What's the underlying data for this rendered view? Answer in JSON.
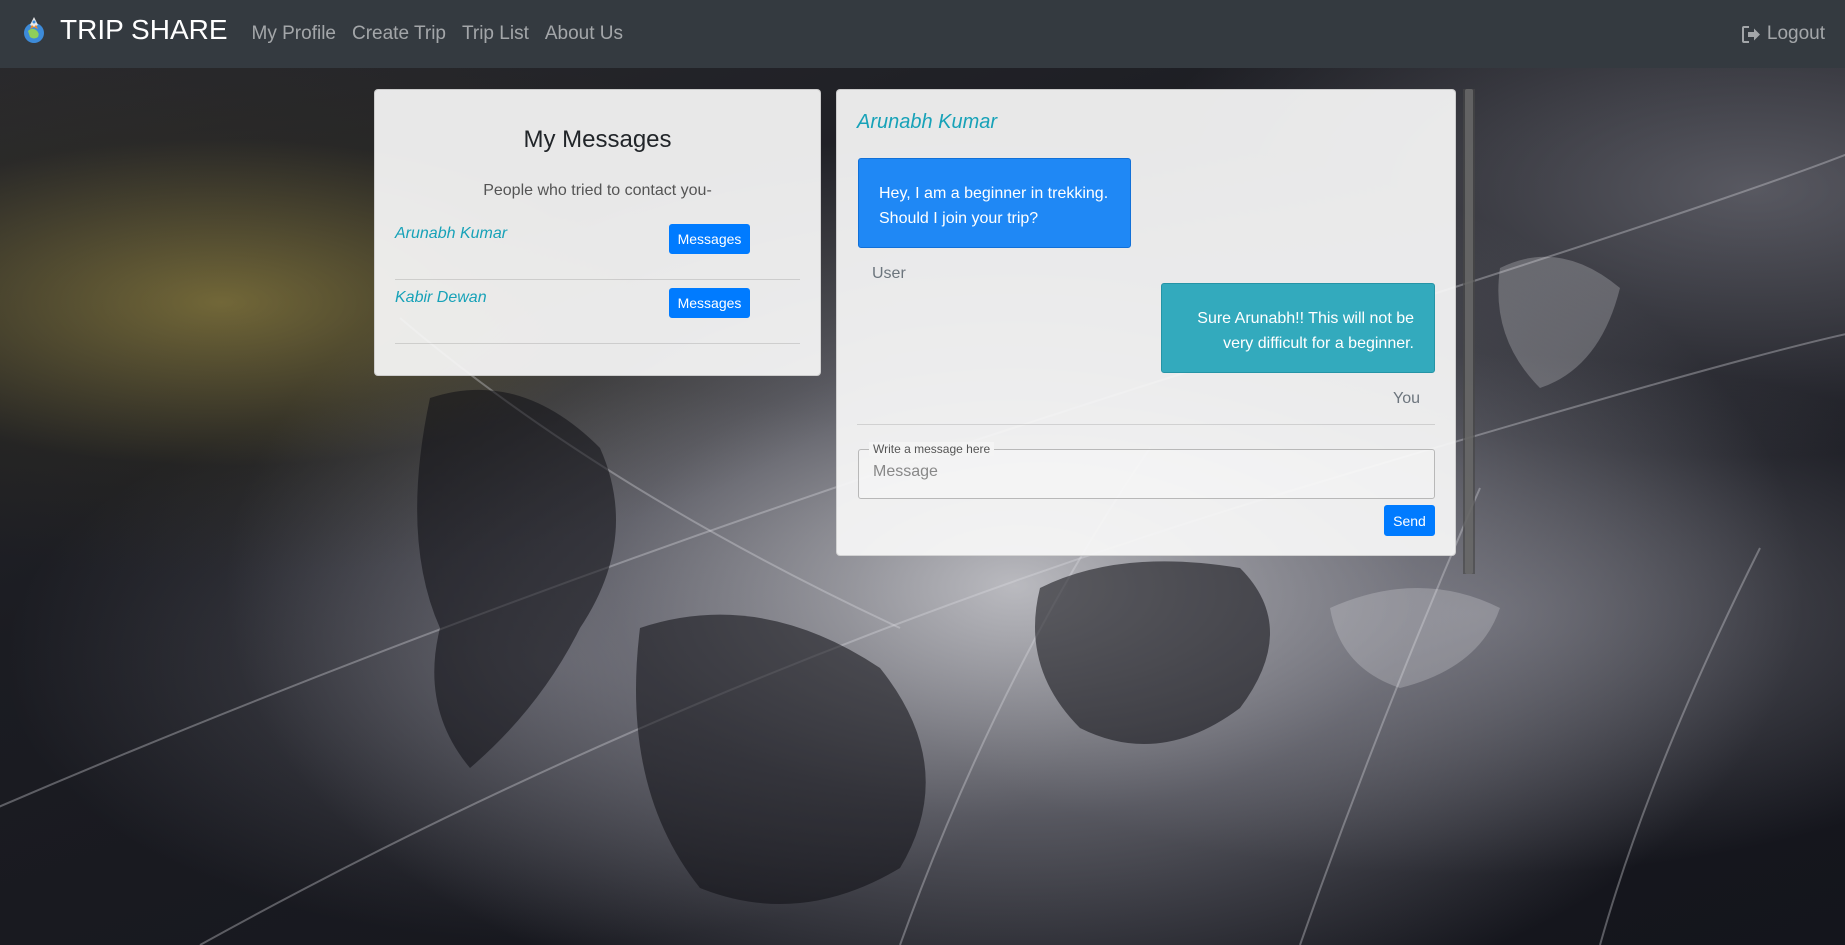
{
  "navbar": {
    "brand_title": "TRIP SHARE",
    "brand_logo_icon": "rocket-globe-logo-icon",
    "links": [
      {
        "label": "My Profile"
      },
      {
        "label": "Create Trip"
      },
      {
        "label": "Trip List"
      },
      {
        "label": "About Us"
      }
    ],
    "logout": {
      "label": "Logout",
      "icon": "sign-out-icon"
    },
    "background_color": "#343a40"
  },
  "messages_panel": {
    "title": "My Messages",
    "subtitle": "People who tried to contact you-",
    "contacts": [
      {
        "name": "Arunabh Kumar",
        "button_label": "Messages"
      },
      {
        "name": "Kabir Dewan",
        "button_label": "Messages"
      }
    ]
  },
  "chat_panel": {
    "contact_name": "Arunabh Kumar",
    "messages": [
      {
        "text": "Hey, I am a beginner in trekking. Should I join your trip?",
        "sender": "User"
      },
      {
        "text": "Sure Arunabh!! This will not be very difficult for a beginner.",
        "sender": "You"
      }
    ],
    "input": {
      "legend": "Write a message here",
      "placeholder": "Message",
      "value": ""
    },
    "send_label": "Send"
  },
  "colors": {
    "accent_teal": "#17a2b8",
    "primary_blue": "#007bff",
    "incoming_bubble": "#1f88f5",
    "outgoing_bubble": "#33aabd"
  }
}
